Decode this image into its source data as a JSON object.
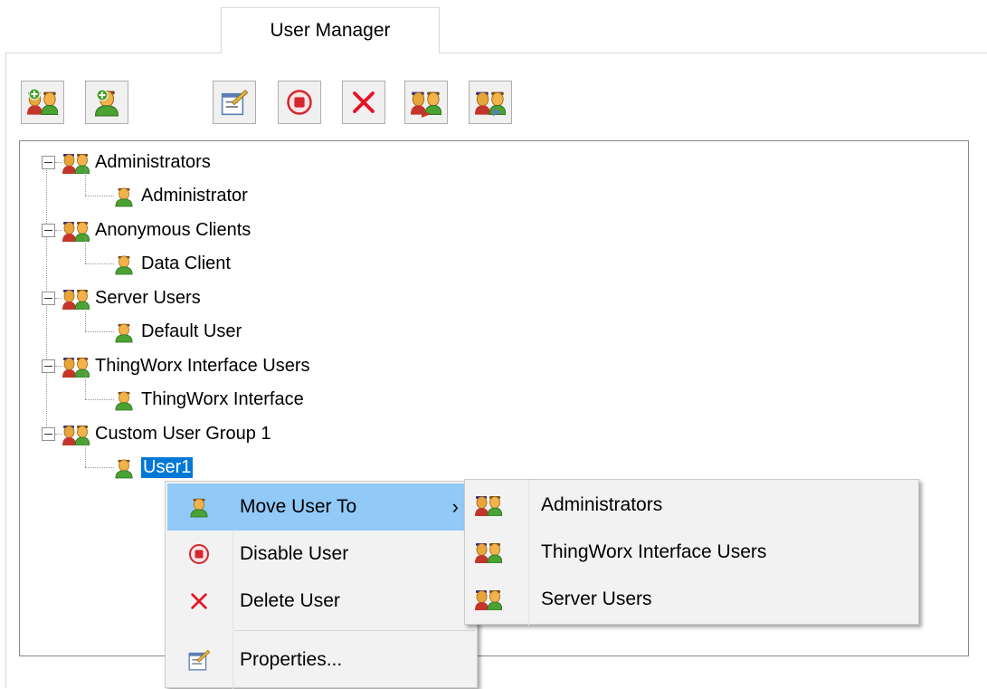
{
  "tab": {
    "label": "User Manager"
  },
  "toolbar": {
    "buttons": [
      {
        "name": "new-user-group-button",
        "icon": "new-group-icon"
      },
      {
        "name": "new-user-button",
        "icon": "new-user-icon"
      },
      {
        "name": "properties-button",
        "icon": "properties-icon"
      },
      {
        "name": "disable-button",
        "icon": "disable-icon"
      },
      {
        "name": "delete-button",
        "icon": "delete-icon"
      },
      {
        "name": "import-button",
        "icon": "import-icon"
      },
      {
        "name": "export-button",
        "icon": "export-icon"
      }
    ]
  },
  "tree": {
    "groups": [
      {
        "label": "Administrators",
        "users": [
          "Administrator"
        ]
      },
      {
        "label": "Anonymous Clients",
        "users": [
          "Data Client"
        ]
      },
      {
        "label": "Server Users",
        "users": [
          "Default User"
        ]
      },
      {
        "label": "ThingWorx Interface Users",
        "users": [
          "ThingWorx Interface"
        ]
      },
      {
        "label": "Custom User Group 1",
        "users": [
          "User1"
        ]
      }
    ],
    "selected": "User1"
  },
  "context_menu": {
    "items": [
      {
        "label": "Move User To",
        "icon": "user-icon",
        "submenu_arrow": "›"
      },
      {
        "label": "Disable User",
        "icon": "disable-icon"
      },
      {
        "label": "Delete User",
        "icon": "delete-icon"
      },
      {
        "label": "Properties...",
        "icon": "properties-icon"
      }
    ]
  },
  "submenu": {
    "items": [
      {
        "label": "Administrators",
        "icon": "group-icon"
      },
      {
        "label": "ThingWorx Interface Users",
        "icon": "group-icon"
      },
      {
        "label": "Server Users",
        "icon": "group-icon"
      }
    ]
  },
  "colors": {
    "selection": "#0078d7",
    "menu_highlight": "#91c9f7",
    "delete_red": "#e81123",
    "disable_red": "#d3272f"
  }
}
